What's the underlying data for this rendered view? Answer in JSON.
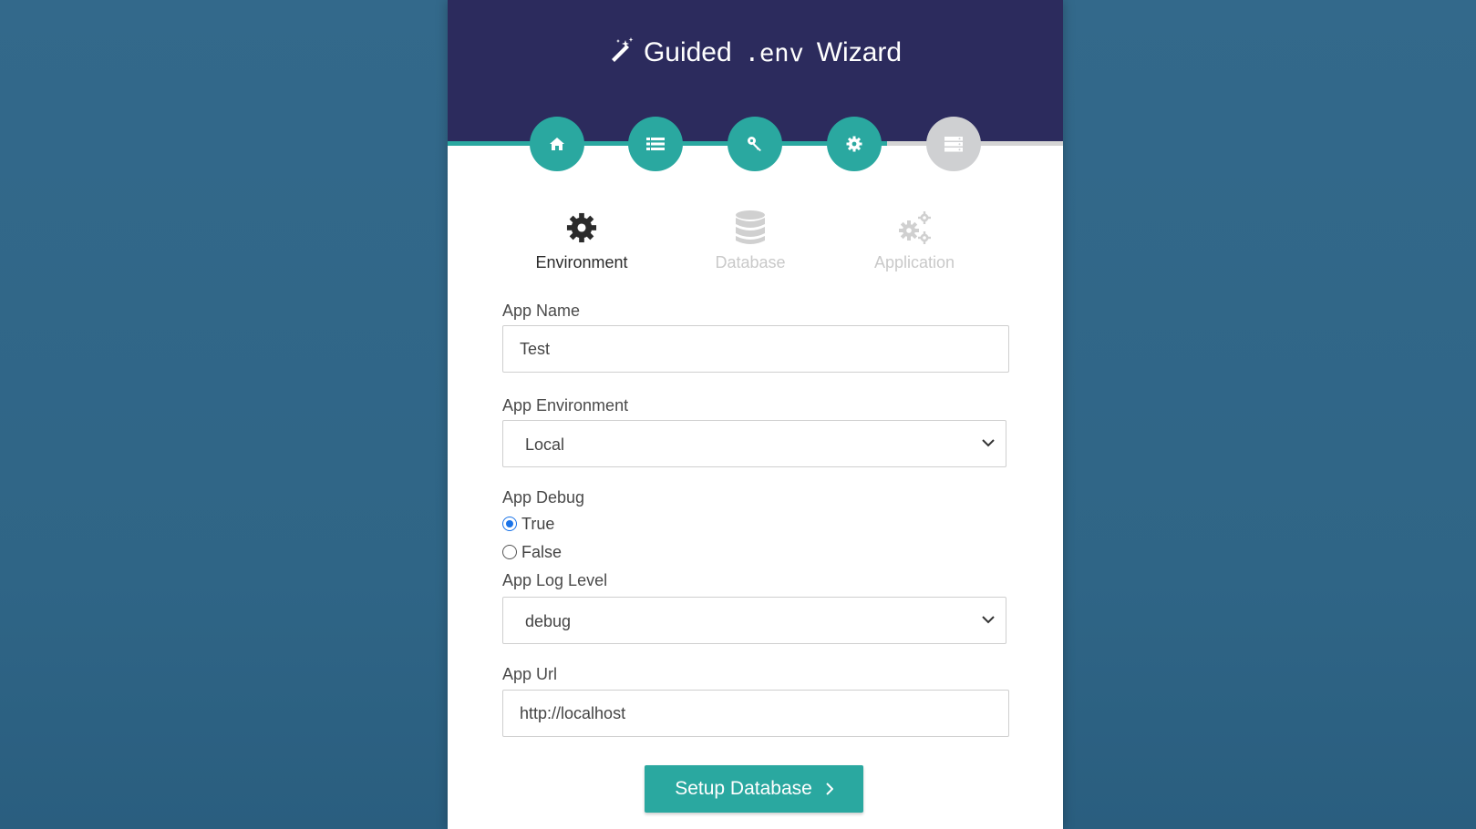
{
  "header": {
    "title_prefix": "Guided",
    "title_mono": ".env",
    "title_suffix": "Wizard",
    "steps": [
      {
        "icon": "home-icon",
        "state": "complete"
      },
      {
        "icon": "list-icon",
        "state": "complete"
      },
      {
        "icon": "key-icon",
        "state": "complete"
      },
      {
        "icon": "gear-icon",
        "state": "current"
      },
      {
        "icon": "server-icon",
        "state": "pending"
      }
    ],
    "progress_percent": 73
  },
  "tabs": [
    {
      "label": "Environment",
      "icon": "gear-icon",
      "active": true
    },
    {
      "label": "Database",
      "icon": "database-icon",
      "active": false
    },
    {
      "label": "Application",
      "icon": "gears-icon",
      "active": false
    }
  ],
  "form": {
    "app_name": {
      "label": "App Name",
      "value": "Test"
    },
    "app_environment": {
      "label": "App Environment",
      "selected": "Local"
    },
    "app_debug": {
      "label": "App Debug",
      "options": [
        {
          "label": "True",
          "checked": true
        },
        {
          "label": "False",
          "checked": false
        }
      ]
    },
    "app_log_level": {
      "label": "App Log Level",
      "selected": "debug"
    },
    "app_url": {
      "label": "App Url",
      "value": "http://localhost"
    }
  },
  "submit": {
    "label": "Setup Database"
  },
  "colors": {
    "header_bg": "#2c2b5d",
    "accent": "#2aa8a0",
    "inactive": "#cfd0d2",
    "page_bg": "#316b8a",
    "radio_checked": "#1a73e8"
  }
}
